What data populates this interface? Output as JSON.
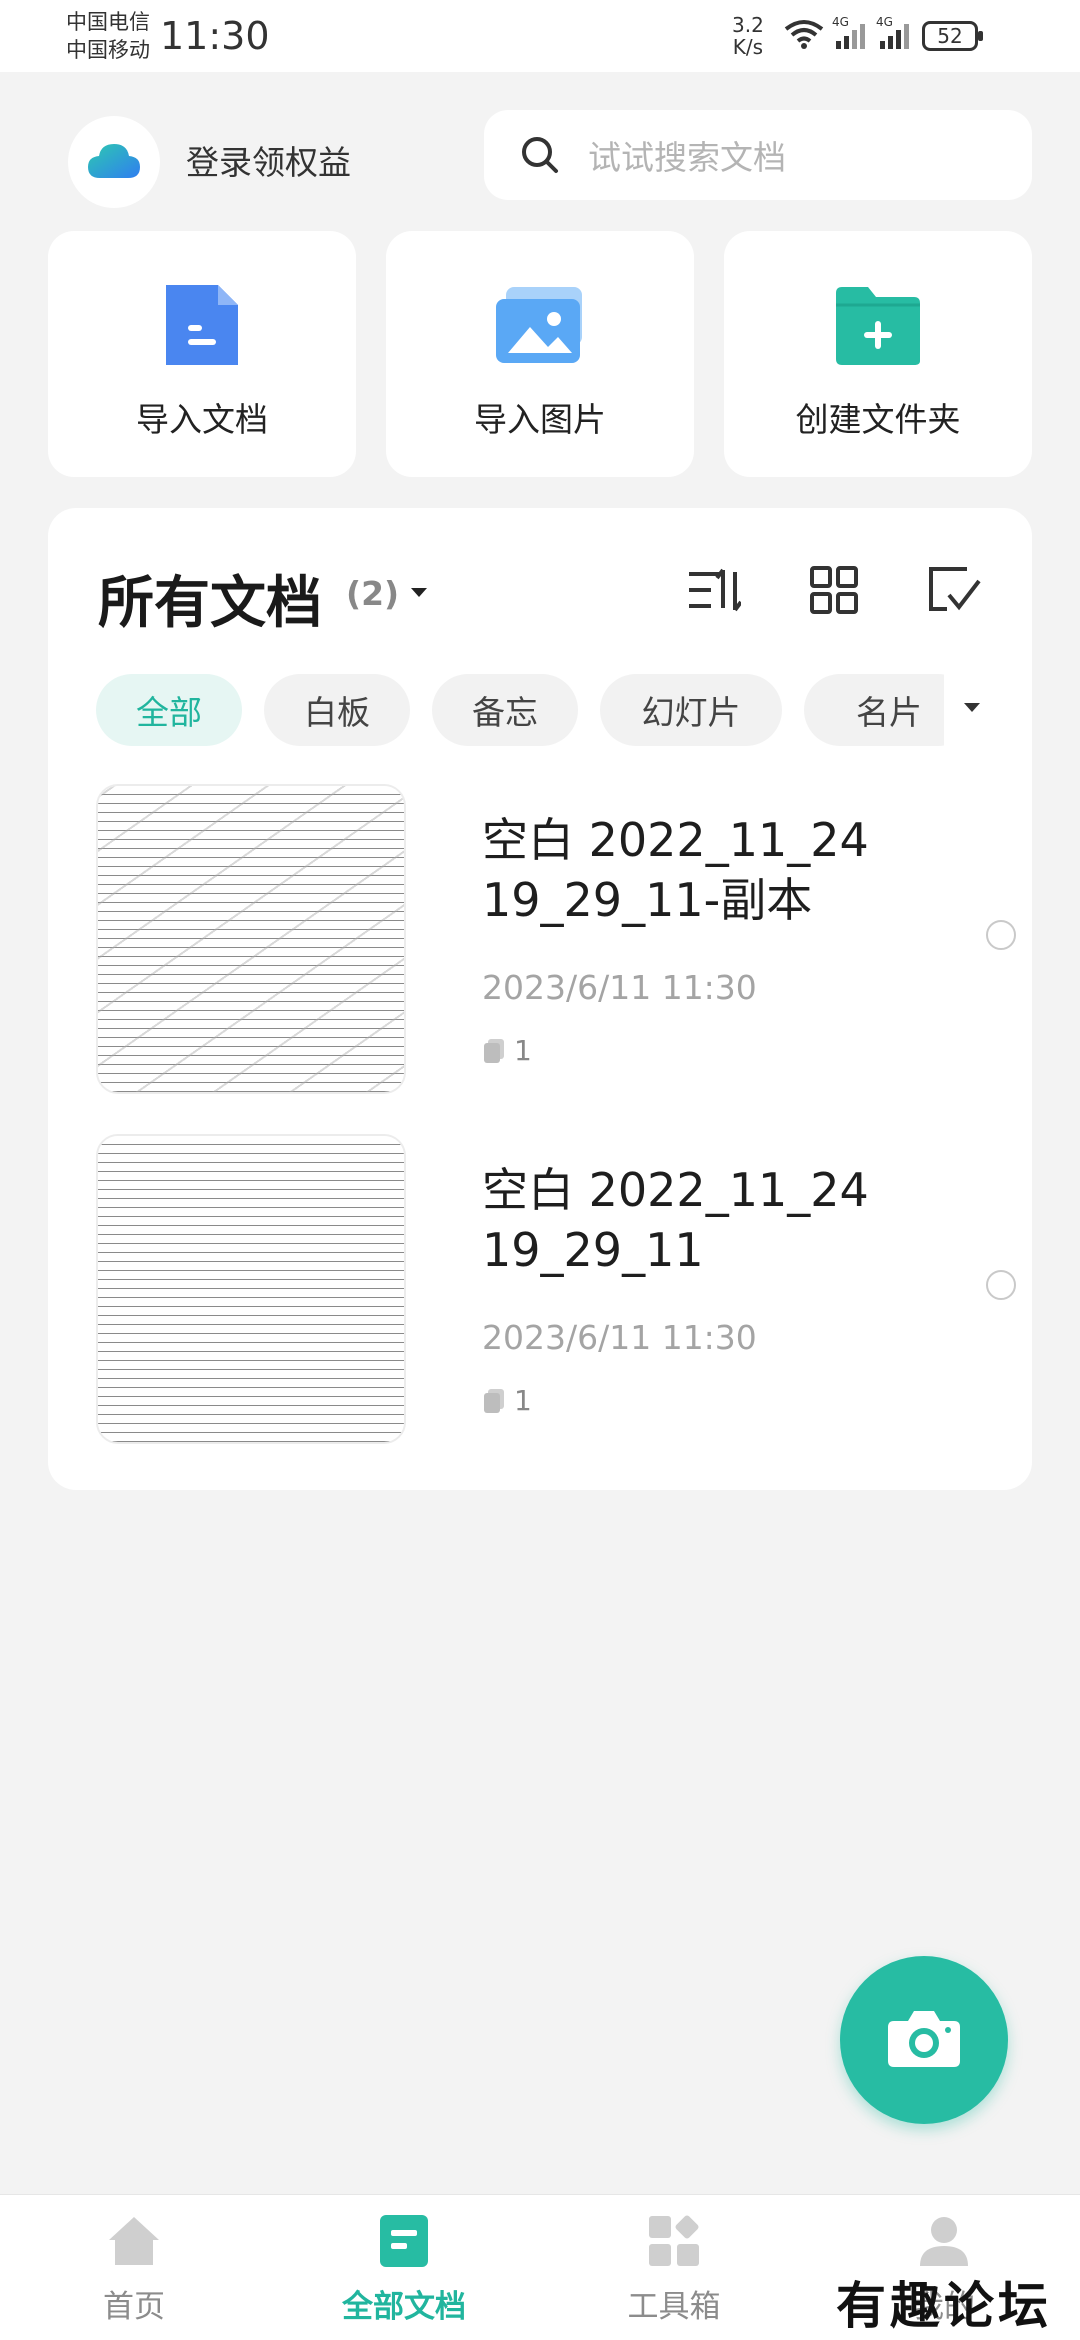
{
  "status_bar": {
    "carrier_1": "中国电信",
    "carrier_2": "中国移动",
    "time": "11:30",
    "net_speed_value": "3.2",
    "net_speed_unit": "K/s",
    "battery": "52",
    "signal_label_1": "4G",
    "signal_label_2": "4G"
  },
  "header": {
    "login_label": "登录领权益",
    "search_placeholder": "试试搜索文档"
  },
  "quick_actions": [
    {
      "label": "导入文档",
      "icon": "document-icon",
      "color": "#4a86f0"
    },
    {
      "label": "导入图片",
      "icon": "image-icon",
      "color": "#5aa8f5"
    },
    {
      "label": "创建文件夹",
      "icon": "folder-add-icon",
      "color": "#27bca3"
    }
  ],
  "documents": {
    "title": "所有文档",
    "count": "(2)",
    "filters": [
      {
        "label": "全部",
        "active": true
      },
      {
        "label": "白板",
        "active": false
      },
      {
        "label": "备忘",
        "active": false
      },
      {
        "label": "幻灯片",
        "active": false
      },
      {
        "label": "名片",
        "active": false
      }
    ],
    "items": [
      {
        "name_line1": "空白 2022_11_24",
        "name_line2": "19_29_11-副本",
        "date": "2023/6/11 11:30",
        "pages": "1"
      },
      {
        "name_line1": "空白 2022_11_24",
        "name_line2": "19_29_11",
        "date": "2023/6/11 11:30",
        "pages": "1"
      }
    ]
  },
  "bottom_nav": [
    {
      "label": "首页",
      "icon": "home-icon",
      "active": false
    },
    {
      "label": "全部文档",
      "icon": "documents-icon",
      "active": true
    },
    {
      "label": "工具箱",
      "icon": "toolbox-icon",
      "active": false
    },
    {
      "label": "我的",
      "icon": "profile-icon",
      "active": false
    }
  ],
  "colors": {
    "accent": "#27bca3",
    "background": "#f3f3f3"
  },
  "watermark": "有趣论坛"
}
